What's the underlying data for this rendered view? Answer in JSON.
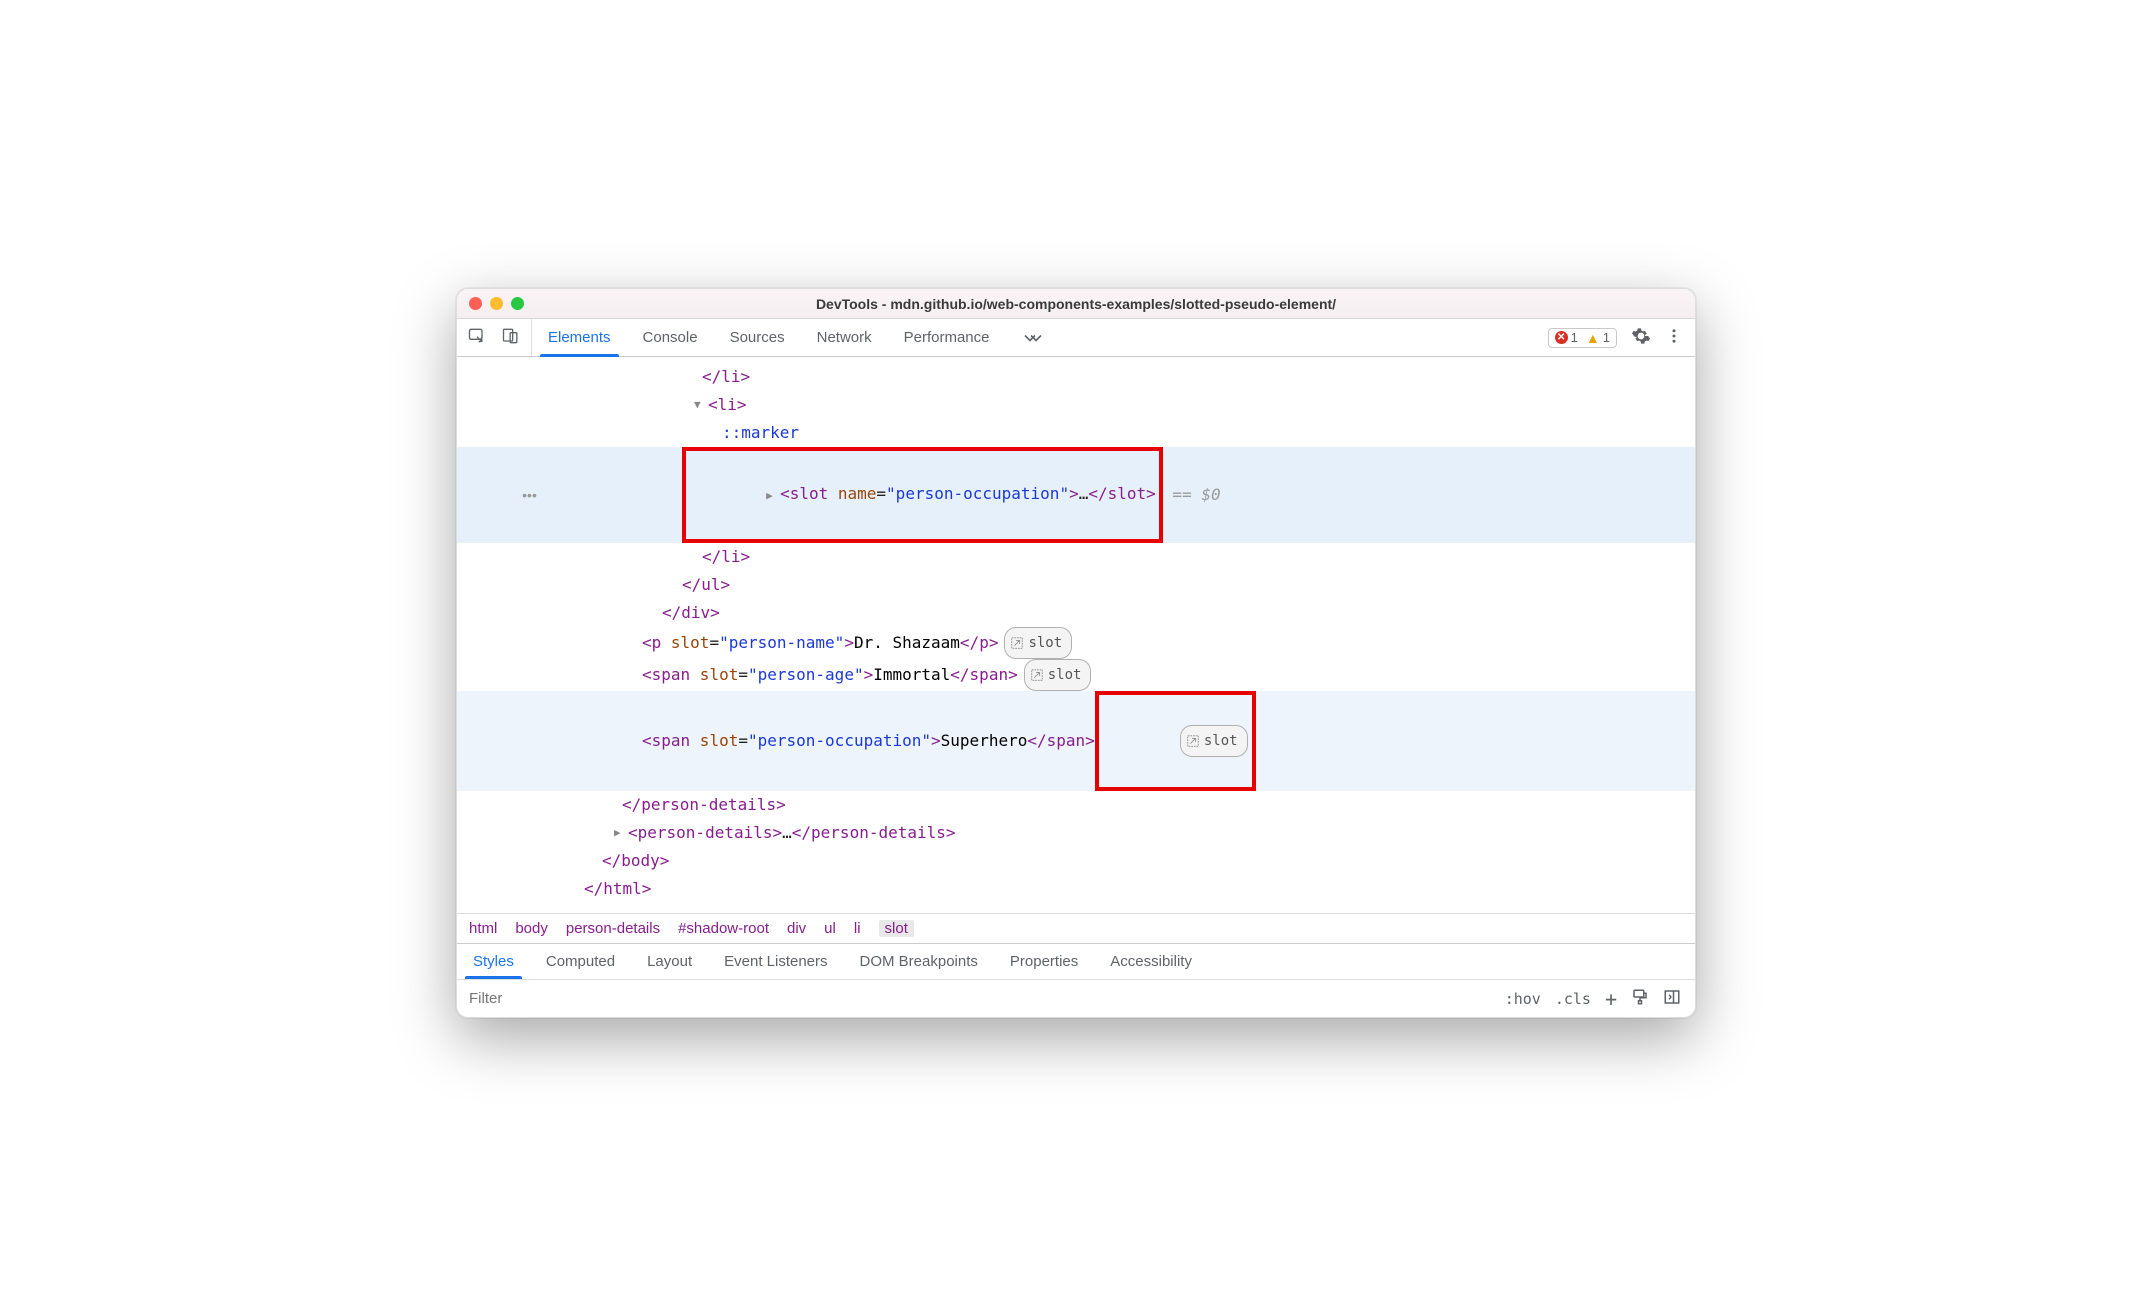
{
  "title": "DevTools - mdn.github.io/web-components-examples/slotted-pseudo-element/",
  "tabs": {
    "t0": "Elements",
    "t1": "Console",
    "t2": "Sources",
    "t3": "Network",
    "t4": "Performance"
  },
  "errors": "1",
  "warnings": "1",
  "code": {
    "li_close": "</li>",
    "li_open": "<li>",
    "marker": "::marker",
    "slot_open": "<slot",
    "slot_attr_n": " name",
    "slot_attr_eq": "=",
    "slot_attr_v": "\"person-occupation\"",
    "slot_gt": ">",
    "ellipsis": "…",
    "slot_close": "</slot>",
    "eq0": " == $0",
    "ul_close": "</ul>",
    "div_close": "</div>",
    "p_open": "<p",
    "span_open": "<span",
    "slot_kw": " slot",
    "eq": "=",
    "pn_v": "\"person-name\"",
    "pa_v": "\"person-age\"",
    "po_v": "\"person-occupation\"",
    "gt": ">",
    "txt_name": "Dr. Shazaam",
    "txt_age": "Immortal",
    "txt_occ": "Superhero",
    "p_close": "</p>",
    "span_close": "</span>",
    "pd_close": "</person-details>",
    "pd_open": "<person-details>",
    "body_close": "</body>",
    "html_close": "</html>",
    "gutter_dots": "•••",
    "slot_badge": "slot"
  },
  "crumbs": {
    "c0": "html",
    "c1": "body",
    "c2": "person-details",
    "c3": "#shadow-root",
    "c4": "div",
    "c5": "ul",
    "c6": "li",
    "c7": "slot"
  },
  "subtabs": {
    "s0": "Styles",
    "s1": "Computed",
    "s2": "Layout",
    "s3": "Event Listeners",
    "s4": "DOM Breakpoints",
    "s5": "Properties",
    "s6": "Accessibility"
  },
  "filter": {
    "placeholder": "Filter",
    "hov": ":hov",
    "cls": ".cls"
  }
}
